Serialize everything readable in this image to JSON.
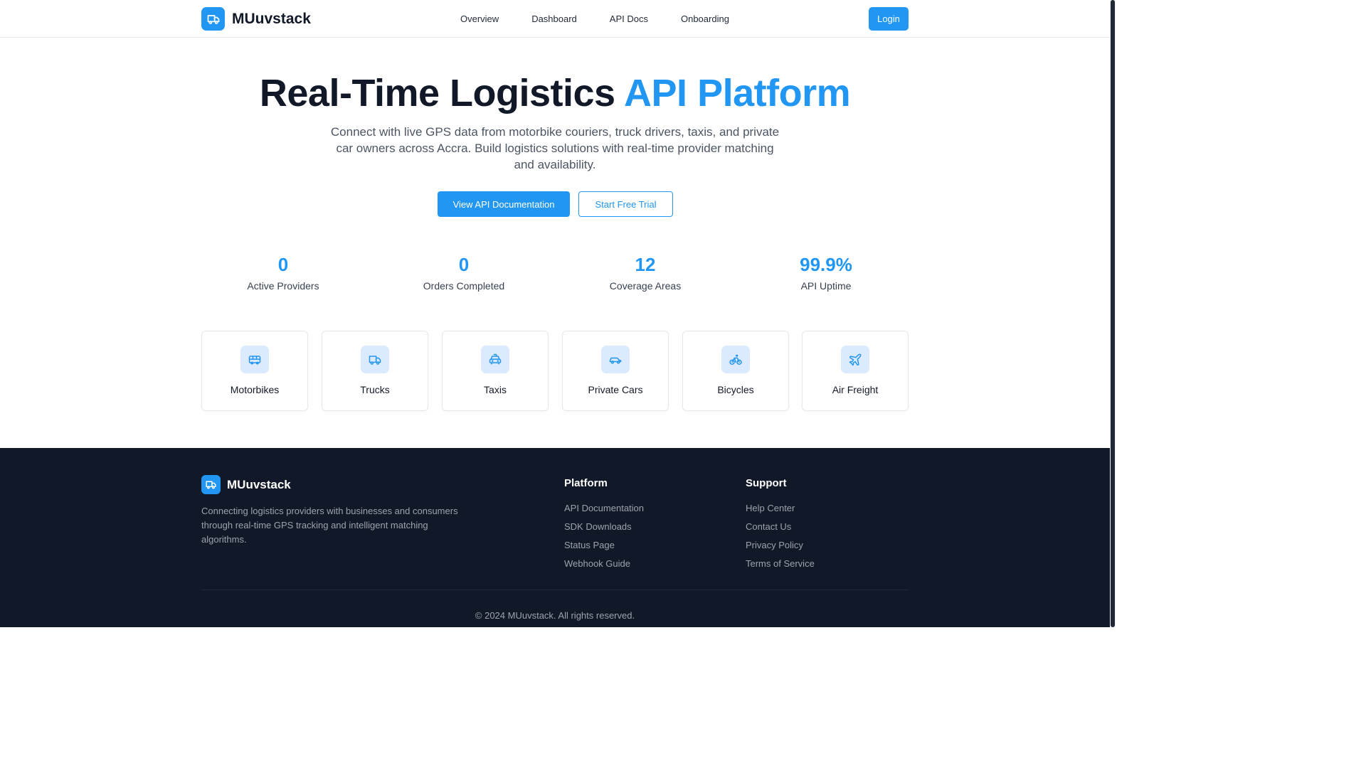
{
  "brand": {
    "name": "MUuvstack",
    "logo_icon": "truck-icon",
    "accent_color": "#2196f3"
  },
  "nav": {
    "items": [
      "Overview",
      "Dashboard",
      "API Docs",
      "Onboarding"
    ],
    "login_label": "Login"
  },
  "hero": {
    "title_main": "Real-Time Logistics ",
    "title_accent": "API Platform",
    "subtitle": "Connect with live GPS data from motorbike couriers, truck drivers, taxis, and private car owners across Accra. Build logistics solutions with real-time provider matching and availability.",
    "primary_button": "View API Documentation",
    "secondary_button": "Start Free Trial"
  },
  "stats": [
    {
      "value": "0",
      "label": "Active Providers"
    },
    {
      "value": "0",
      "label": "Orders Completed"
    },
    {
      "value": "12",
      "label": "Coverage Areas"
    },
    {
      "value": "99.9%",
      "label": "API Uptime"
    }
  ],
  "vehicles": [
    {
      "label": "Motorbikes",
      "icon": "bus-icon"
    },
    {
      "label": "Trucks",
      "icon": "truck-icon"
    },
    {
      "label": "Taxis",
      "icon": "taxi-icon"
    },
    {
      "label": "Private Cars",
      "icon": "car-icon"
    },
    {
      "label": "Bicycles",
      "icon": "bicycle-icon"
    },
    {
      "label": "Air Freight",
      "icon": "plane-icon"
    }
  ],
  "footer": {
    "brand_name": "MUuvstack",
    "description": "Connecting logistics providers with businesses and consumers through real-time GPS tracking and intelligent matching algorithms.",
    "platform": {
      "title": "Platform",
      "links": [
        "API Documentation",
        "SDK Downloads",
        "Status Page",
        "Webhook Guide"
      ]
    },
    "support": {
      "title": "Support",
      "links": [
        "Help Center",
        "Contact Us",
        "Privacy Policy",
        "Terms of Service"
      ]
    },
    "copyright": "© 2024 MUuvstack. All rights reserved."
  }
}
